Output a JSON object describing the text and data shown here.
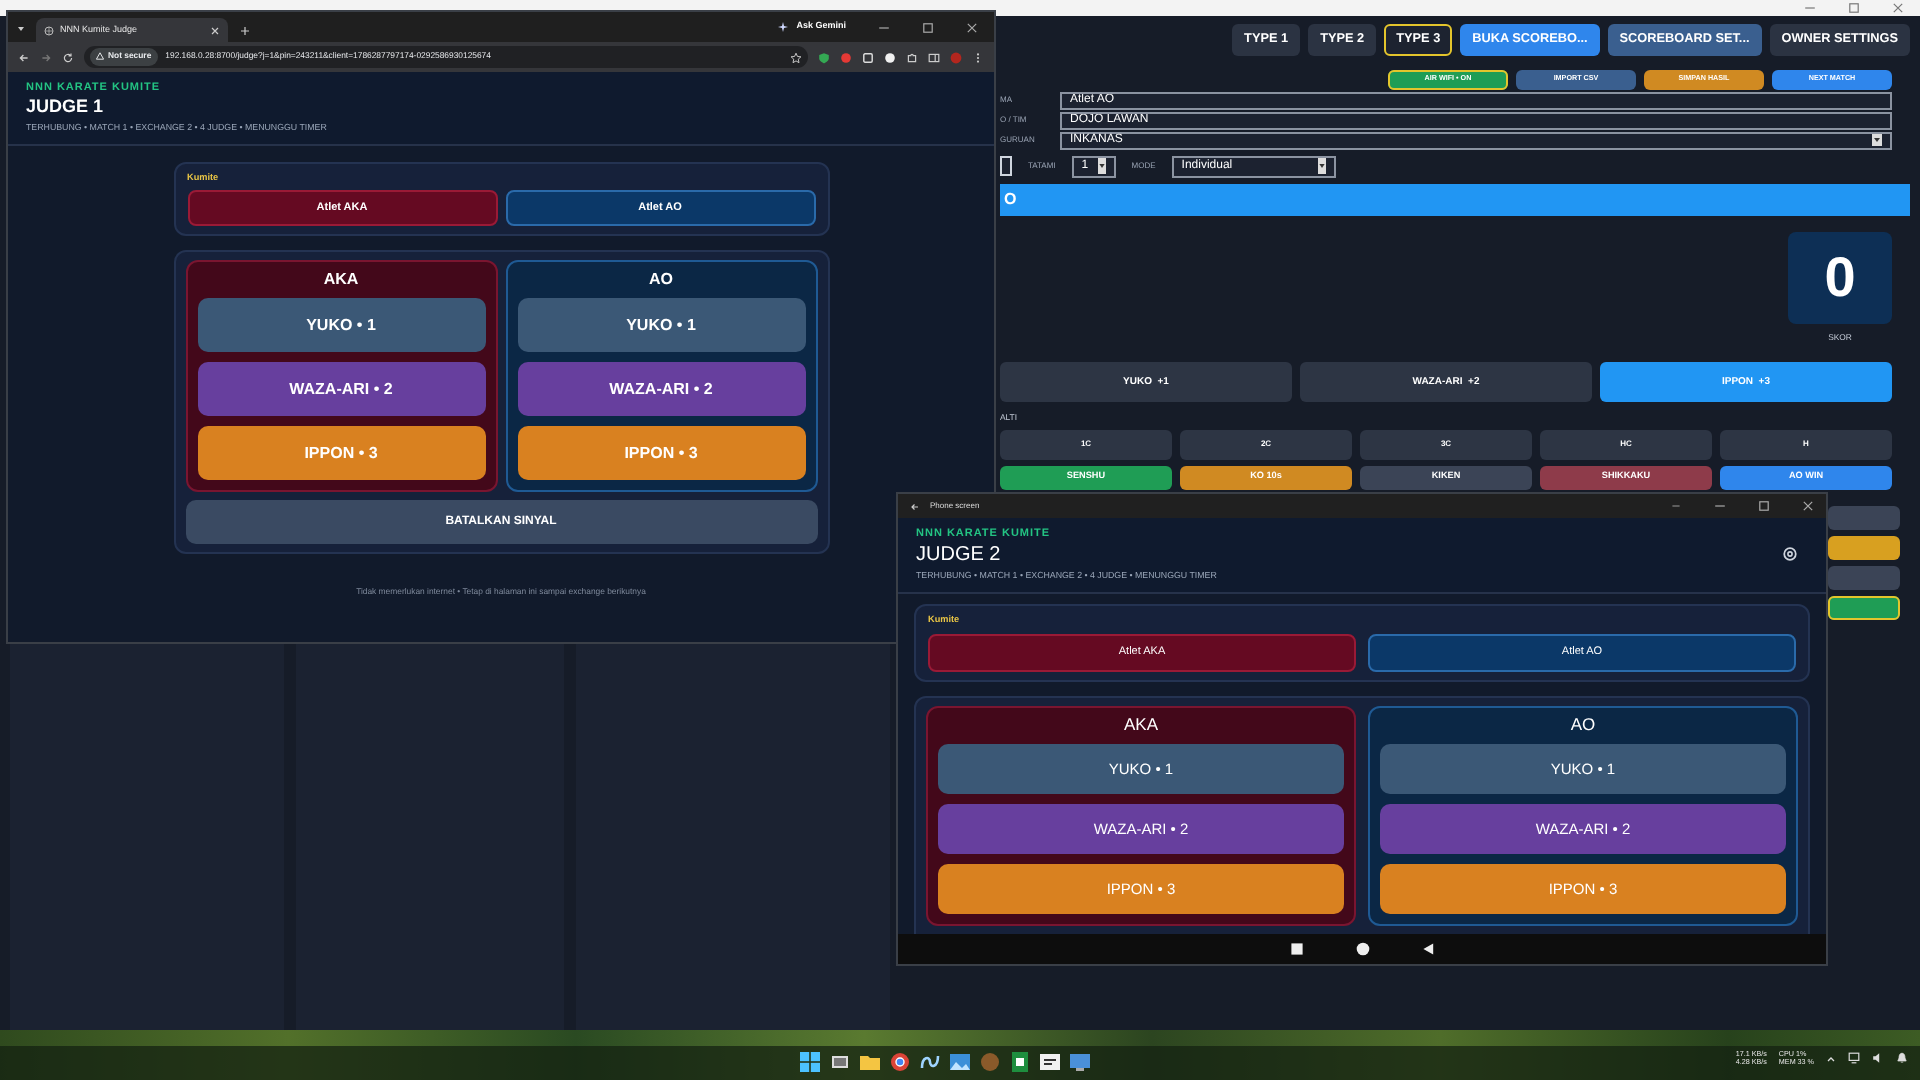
{
  "admin_window": {
    "header_tabs": [
      {
        "label": "TYPE 1",
        "selected": false
      },
      {
        "label": "TYPE 2",
        "selected": false
      },
      {
        "label": "TYPE 3",
        "selected": true
      }
    ],
    "header_buttons": [
      {
        "label": "BUKA SCOREBO...",
        "kind": "primary"
      },
      {
        "label": "SCOREBOARD SET...",
        "kind": "steel"
      },
      {
        "label": "OWNER SETTINGS",
        "kind": "dark"
      }
    ],
    "toolbar_buttons": [
      {
        "label": "AIR WIFI • ON",
        "kind": "success",
        "selected": true
      },
      {
        "label": "IMPORT CSV",
        "kind": "steel",
        "selected": false
      },
      {
        "label": "SIMPAN HASIL",
        "kind": "warning",
        "selected": false
      },
      {
        "label": "NEXT MATCH",
        "kind": "primary",
        "selected": false
      }
    ],
    "fields": [
      {
        "label": "MA",
        "value": "Atlet AO",
        "kind": "text"
      },
      {
        "label": "O / TIM",
        "value": "DOJO LAWAN",
        "kind": "text"
      },
      {
        "label": "GURUAN",
        "value": "INKANAS",
        "kind": "select"
      }
    ],
    "tatami": {
      "checked": false,
      "label": "TATAMI",
      "value": "1"
    },
    "mode": {
      "label": "MODE",
      "value": "Individual"
    },
    "banner": "O",
    "score": {
      "value": "0",
      "label": "SKOR"
    },
    "score_buttons": [
      {
        "label": "YUKO  +1",
        "selected": false
      },
      {
        "label": "WAZA-ARI  +2",
        "selected": false
      },
      {
        "label": "IPPON  +3",
        "selected": true
      }
    ],
    "penalty_label": "ALTI",
    "penalty_buttons": [
      "1C",
      "2C",
      "3C",
      "HC",
      "H"
    ],
    "decision_buttons": [
      {
        "label": "SENSHU",
        "kind": "success"
      },
      {
        "label": "KO 10s",
        "kind": "warning"
      },
      {
        "label": "KIKEN",
        "kind": "secondary"
      },
      {
        "label": "SHIKKAKU",
        "kind": "danger"
      },
      {
        "label": "AO WIN",
        "kind": "primary"
      }
    ],
    "side_buttons": [
      {
        "kind": "secondary",
        "selected": false
      },
      {
        "kind": "warning",
        "selected": false
      },
      {
        "kind": "secondary",
        "selected": false
      },
      {
        "kind": "success",
        "selected": true
      }
    ]
  },
  "browser_window": {
    "tab_title": "NNN Kumite Judge",
    "assistant_button": "Ask Gemini",
    "security_label": "Not secure",
    "url": "192.168.0.28:8700/judge?j=1&pin=243211&client=1786287797174-0292586930125674",
    "judge": {
      "kind": "browser",
      "brand": "NNN KARATE KUMITE",
      "title": "JUDGE 1",
      "status": "TERHUBUNG • MATCH 1 • EXCHANGE 2 • 4 JUDGE • MENUNGGU TIMER",
      "category": "Kumite",
      "athletes": [
        {
          "label": "Atlet AKA",
          "kind": "aka"
        },
        {
          "label": "Atlet AO",
          "kind": "ao"
        }
      ],
      "corners": [
        {
          "name": "AKA",
          "kind": "aka",
          "scores": [
            {
              "label": "YUKO • 1",
              "kind": "yuko"
            },
            {
              "label": "WAZA-ARI • 2",
              "kind": "wazaari"
            },
            {
              "label": "IPPON • 3",
              "kind": "ippon"
            }
          ]
        },
        {
          "name": "AO",
          "kind": "ao",
          "scores": [
            {
              "label": "YUKO • 1",
              "kind": "yuko"
            },
            {
              "label": "WAZA-ARI • 2",
              "kind": "wazaari"
            },
            {
              "label": "IPPON • 3",
              "kind": "ippon"
            }
          ]
        }
      ],
      "cancel": "BATALKAN SINYAL",
      "footer": "Tidak memerlukan internet • Tetap di halaman ini sampai exchange berikutnya"
    }
  },
  "phone_window": {
    "title": "Phone screen",
    "judge": {
      "kind": "phone",
      "brand": "NNN KARATE KUMITE",
      "title": "JUDGE 2",
      "status": "TERHUBUNG • MATCH 1 • EXCHANGE 2 • 4 JUDGE • MENUNGGU TIMER",
      "category": "Kumite",
      "athletes": [
        {
          "label": "Atlet AKA",
          "kind": "aka"
        },
        {
          "label": "Atlet AO",
          "kind": "ao"
        }
      ],
      "corners": [
        {
          "name": "AKA",
          "kind": "aka",
          "scores": [
            {
              "label": "YUKO • 1",
              "kind": "yuko"
            },
            {
              "label": "WAZA-ARI • 2",
              "kind": "wazaari"
            },
            {
              "label": "IPPON • 3",
              "kind": "ippon"
            }
          ]
        },
        {
          "name": "AO",
          "kind": "ao",
          "scores": [
            {
              "label": "YUKO • 1",
              "kind": "yuko"
            },
            {
              "label": "WAZA-ARI • 2",
              "kind": "wazaari"
            },
            {
              "label": "IPPON • 3",
              "kind": "ippon"
            }
          ]
        }
      ]
    }
  },
  "taskbar": {
    "tray": [
      {
        "top": "17.1 KB/s",
        "bottom": "4.28 KB/s"
      },
      {
        "top": "CPU 1%",
        "bottom": "MEM 33 %"
      }
    ]
  }
}
